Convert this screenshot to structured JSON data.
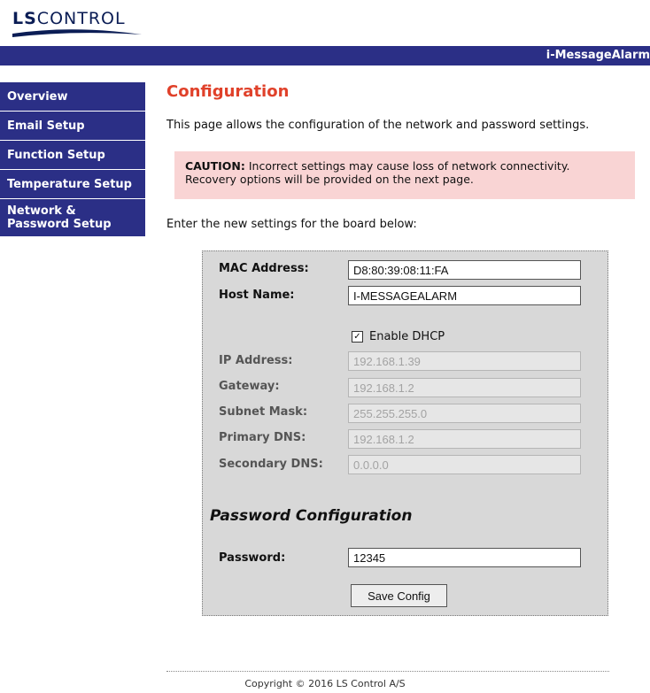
{
  "logo": {
    "brand_bold": "LS",
    "brand_rest": "CONTROL"
  },
  "header": {
    "app_name": "i-MessageAlarm"
  },
  "sidebar": {
    "items": [
      {
        "label": "Overview"
      },
      {
        "label": "Email Setup"
      },
      {
        "label": "Function Setup"
      },
      {
        "label": "Temperature Setup"
      },
      {
        "label": "Network &"
      },
      {
        "label": "Password Setup"
      }
    ]
  },
  "main": {
    "title": "Configuration",
    "intro": "This page allows the configuration of the network and password settings.",
    "caution": {
      "label": "CAUTION:",
      "line1": " Incorrect settings may cause loss of network connectivity.",
      "line2": "Recovery options will be provided on the next page."
    },
    "enter_text": "Enter the new settings for the board below:"
  },
  "form": {
    "mac": {
      "label": "MAC Address:",
      "value": "D8:80:39:08:11:FA"
    },
    "host": {
      "label": "Host Name:",
      "value": "I-MESSAGEALARM"
    },
    "dhcp": {
      "label": "Enable DHCP",
      "checked": true,
      "check_glyph": "✓"
    },
    "ip": {
      "label": "IP Address:",
      "value": "192.168.1.39"
    },
    "gateway": {
      "label": "Gateway:",
      "value": "192.168.1.2"
    },
    "subnet": {
      "label": "Subnet Mask:",
      "value": "255.255.255.0"
    },
    "dns1": {
      "label": "Primary DNS:",
      "value": "192.168.1.2"
    },
    "dns2": {
      "label": "Secondary DNS:",
      "value": "0.0.0.0"
    },
    "password_heading": "Password Configuration",
    "password": {
      "label": "Password:",
      "value": "12345"
    },
    "save_label": "Save Config"
  },
  "footer": {
    "copyright": "Copyright © 2016 LS Control A/S"
  },
  "colors": {
    "nav": "#2b2f86",
    "title": "#e0412a",
    "caution_bg": "#f9d4d4",
    "panel_bg": "#d8d8d8"
  }
}
